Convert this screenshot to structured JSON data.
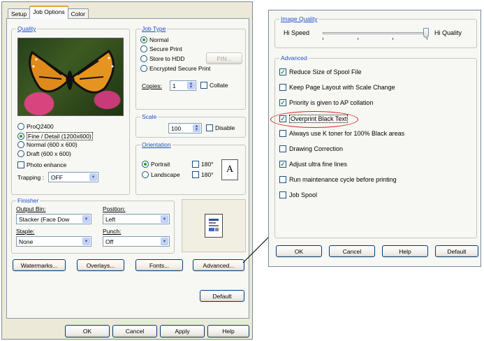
{
  "tabs": [
    "Setup",
    "Job Options",
    "Color"
  ],
  "quality": {
    "label": "Quality",
    "options": [
      "ProQ2400",
      "Fine / Detail (1200x600)",
      "Normal (600 x 600)",
      "Draft (600 x 600)"
    ],
    "selected": 1,
    "photo_enhance": "Photo enhance",
    "trapping_label": "Trapping :",
    "trapping_value": "OFF"
  },
  "job_type": {
    "label": "Job Type",
    "options": [
      "Normal",
      "Secure Print",
      "Store to HDD",
      "Encrypted Secure Print"
    ],
    "selected": 0,
    "pin_button": "PIN...",
    "copies_label": "Copies:",
    "copies_value": "1",
    "collate": "Collate"
  },
  "scale": {
    "label": "Scale",
    "value": "100",
    "disable": "Disable"
  },
  "orientation": {
    "label": "Orientation",
    "portrait": "Portrait",
    "landscape": "Landscape",
    "rot180_a": "180°",
    "rot180_b": "180°",
    "preview_letter": "A"
  },
  "finisher": {
    "label": "Finisher",
    "output_bin_label": "Output Bin:",
    "output_bin_value": "Stacker (Face Dow",
    "position_label": "Position:",
    "position_value": "Left",
    "staple_label": "Staple:",
    "staple_value": "None",
    "punch_label": "Punch:",
    "punch_value": "Off"
  },
  "buttons_row": [
    "Watermarks...",
    "Overlays...",
    "Fonts...",
    "Advanced..."
  ],
  "default_button": "Default",
  "bottom_buttons": [
    "OK",
    "Cancel",
    "Apply",
    "Help"
  ],
  "advanced_dialog": {
    "image_quality_label": "Image Quality",
    "hi_speed": "Hi Speed",
    "hi_quality": "Hi Quality",
    "slider_level_fraction": 1.0,
    "advanced_label": "Advanced",
    "items": [
      {
        "label": "Reduce Size of Spool File",
        "checked": true
      },
      {
        "label": "Keep Page Layout with Scale Change",
        "checked": false
      },
      {
        "label": "Priority is given to AP collation",
        "checked": true
      },
      {
        "label": "Overprint Black Text",
        "checked": true
      },
      {
        "label": "Always use K toner for 100% Black areas",
        "checked": false
      },
      {
        "label": "Drawing Correction",
        "checked": false
      },
      {
        "label": "Adjust ultra fine lines",
        "checked": true
      },
      {
        "label": "Run maintenance cycle before printing",
        "checked": false
      },
      {
        "label": "Job Spool",
        "checked": false
      }
    ],
    "buttons": [
      "OK",
      "Cancel",
      "Help",
      "Default"
    ]
  },
  "colors": {
    "accent_label": "#1e4fcf",
    "highlight_ellipse": "#d9261c"
  }
}
